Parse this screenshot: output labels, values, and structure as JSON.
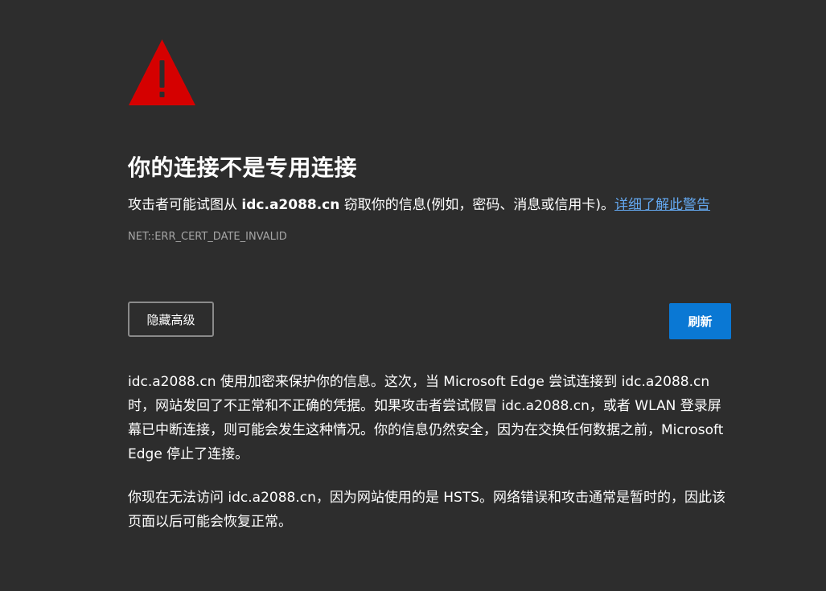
{
  "page": {
    "title": "你的连接不是专用连接",
    "summary_prefix": "攻击者可能试图从 ",
    "summary_host": "idc.a2088.cn",
    "summary_suffix": " 窃取你的信息(例如，密码、消息或信用卡)。",
    "learn_more_link": "详细了解此警告",
    "error_code": "NET::ERR_CERT_DATE_INVALID"
  },
  "buttons": {
    "advanced_label": "隐藏高级",
    "refresh_label": "刷新"
  },
  "details": {
    "paragraph1": "idc.a2088.cn 使用加密来保护你的信息。这次，当 Microsoft Edge 尝试连接到 idc.a2088.cn 时，网站发回了不正常和不正确的凭据。如果攻击者尝试假冒 idc.a2088.cn，或者 WLAN 登录屏幕已中断连接，则可能会发生这种情况。你的信息仍然安全，因为在交换任何数据之前，Microsoft Edge 停止了连接。",
    "paragraph2": "你现在无法访问 idc.a2088.cn，因为网站使用的是 HSTS。网络错误和攻击通常是暂时的，因此该页面以后可能会恢复正常。"
  },
  "icons": {
    "warning": "warning-triangle-icon"
  },
  "colors": {
    "background": "#2d2d2d",
    "warning_red": "#d50000",
    "link": "#64a8f0",
    "primary_button": "#0a78d4",
    "muted_text": "#a6a6a6"
  }
}
